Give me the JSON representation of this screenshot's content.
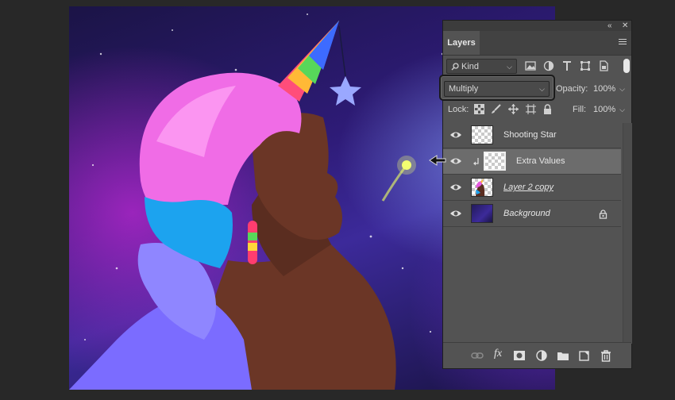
{
  "panel": {
    "tab_label": "Layers",
    "collapse_glyph": "«",
    "close_glyph": "✕",
    "filter": {
      "kind_label": "Kind"
    },
    "blend_mode": "Multiply",
    "opacity_label": "Opacity:",
    "opacity_value": "100%",
    "lock_label": "Lock:",
    "fill_label": "Fill:",
    "fill_value": "100%",
    "layers": [
      {
        "name": "Shooting Star",
        "selected": false,
        "clipped": false,
        "visible": true
      },
      {
        "name": "Extra Values",
        "selected": true,
        "clipped": true,
        "visible": true
      },
      {
        "name": "Layer 2 copy",
        "selected": false,
        "clipped": false,
        "visible": true
      },
      {
        "name": "Background",
        "selected": false,
        "clipped": false,
        "visible": true,
        "locked": true
      }
    ],
    "bottom_icons": [
      "link-icon",
      "fx-icon",
      "mask-icon",
      "adjustment-icon",
      "folder-icon",
      "new-layer-icon",
      "trash-icon"
    ],
    "filter_icons": [
      "image-filter-icon",
      "adjustment-filter-icon",
      "type-filter-icon",
      "shape-filter-icon",
      "smart-object-filter-icon"
    ],
    "fx_label": "fx"
  },
  "colors": {
    "panel_bg": "#535353",
    "selected_row": "#6c6c6c",
    "workspace": "#282828"
  }
}
